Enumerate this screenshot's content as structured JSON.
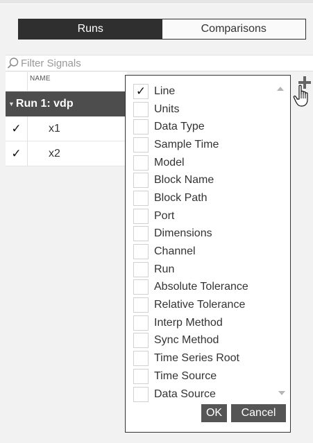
{
  "toggle": {
    "runs_label": "Runs",
    "comparisons_label": "Comparisons",
    "active": "runs"
  },
  "filter": {
    "placeholder": "Filter Signals",
    "icon": "search-icon"
  },
  "table": {
    "name_header": "NAME",
    "run": {
      "label": "Run 1: vdp"
    },
    "signals": [
      {
        "name": "x1",
        "checked": true
      },
      {
        "name": "x2",
        "checked": true
      }
    ]
  },
  "column_menu": {
    "items": [
      {
        "label": "Line",
        "checked": true
      },
      {
        "label": "Units",
        "checked": false
      },
      {
        "label": "Data Type",
        "checked": false
      },
      {
        "label": "Sample Time",
        "checked": false
      },
      {
        "label": "Model",
        "checked": false
      },
      {
        "label": "Block Name",
        "checked": false
      },
      {
        "label": "Block Path",
        "checked": false
      },
      {
        "label": "Port",
        "checked": false
      },
      {
        "label": "Dimensions",
        "checked": false
      },
      {
        "label": "Channel",
        "checked": false
      },
      {
        "label": "Run",
        "checked": false
      },
      {
        "label": "Absolute Tolerance",
        "checked": false
      },
      {
        "label": "Relative Tolerance",
        "checked": false
      },
      {
        "label": "Interp Method",
        "checked": false
      },
      {
        "label": "Sync Method",
        "checked": false
      },
      {
        "label": "Time Series Root",
        "checked": false
      },
      {
        "label": "Time Source",
        "checked": false
      },
      {
        "label": "Data Source",
        "checked": false
      }
    ],
    "ok_label": "OK",
    "cancel_label": "Cancel"
  },
  "icons": {
    "add_column": "plus-icon",
    "cursor": "hand-cursor-icon",
    "check": "✓"
  },
  "colors": {
    "toggle_active_bg": "#2f2f2f",
    "run_row_bg": "#4d4d4d",
    "button_bg": "#555555"
  }
}
